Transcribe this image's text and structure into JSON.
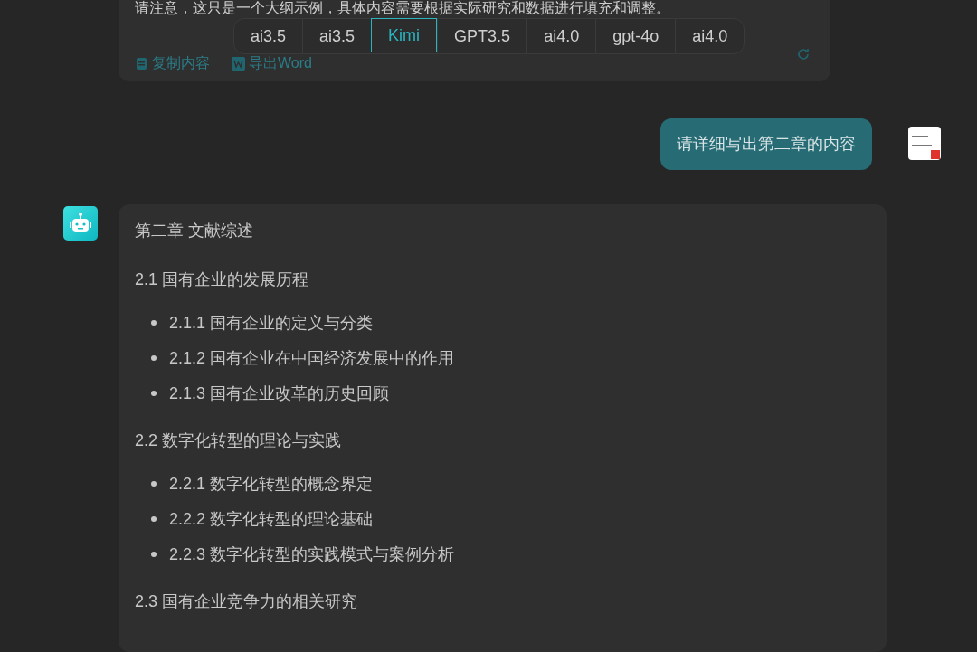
{
  "previous_reply": {
    "text": "请注意，这只是一个大纲示例，具体内容需要根据实际研究和数据进行填充和调整。",
    "actions": [
      "复制内容",
      "导出Word"
    ]
  },
  "model_tabs": [
    {
      "label": "ai3.5",
      "selected": false
    },
    {
      "label": "ai3.5",
      "selected": false
    },
    {
      "label": "Kimi",
      "selected": true
    },
    {
      "label": "GPT3.5",
      "selected": false
    },
    {
      "label": "ai4.0",
      "selected": false
    },
    {
      "label": "gpt-4o",
      "selected": false
    },
    {
      "label": "ai4.0",
      "selected": false
    }
  ],
  "user_message": "请详细写出第二章的内容",
  "reply": {
    "blocks": [
      {
        "kind": "paragraph",
        "text": "第二章 文献综述"
      },
      {
        "kind": "paragraph",
        "text": "2.1 国有企业的发展历程"
      },
      {
        "kind": "list",
        "items": [
          "2.1.1 国有企业的定义与分类",
          "2.1.2 国有企业在中国经济发展中的作用",
          "2.1.3 国有企业改革的历史回顾"
        ]
      },
      {
        "kind": "paragraph",
        "text": "2.2 数字化转型的理论与实践"
      },
      {
        "kind": "list",
        "items": [
          "2.2.1 数字化转型的概念界定",
          "2.2.2 数字化转型的理论基础",
          "2.2.3 数字化转型的实践模式与案例分析"
        ]
      },
      {
        "kind": "paragraph",
        "text": "2.3 国有企业竞争力的相关研究"
      }
    ]
  }
}
